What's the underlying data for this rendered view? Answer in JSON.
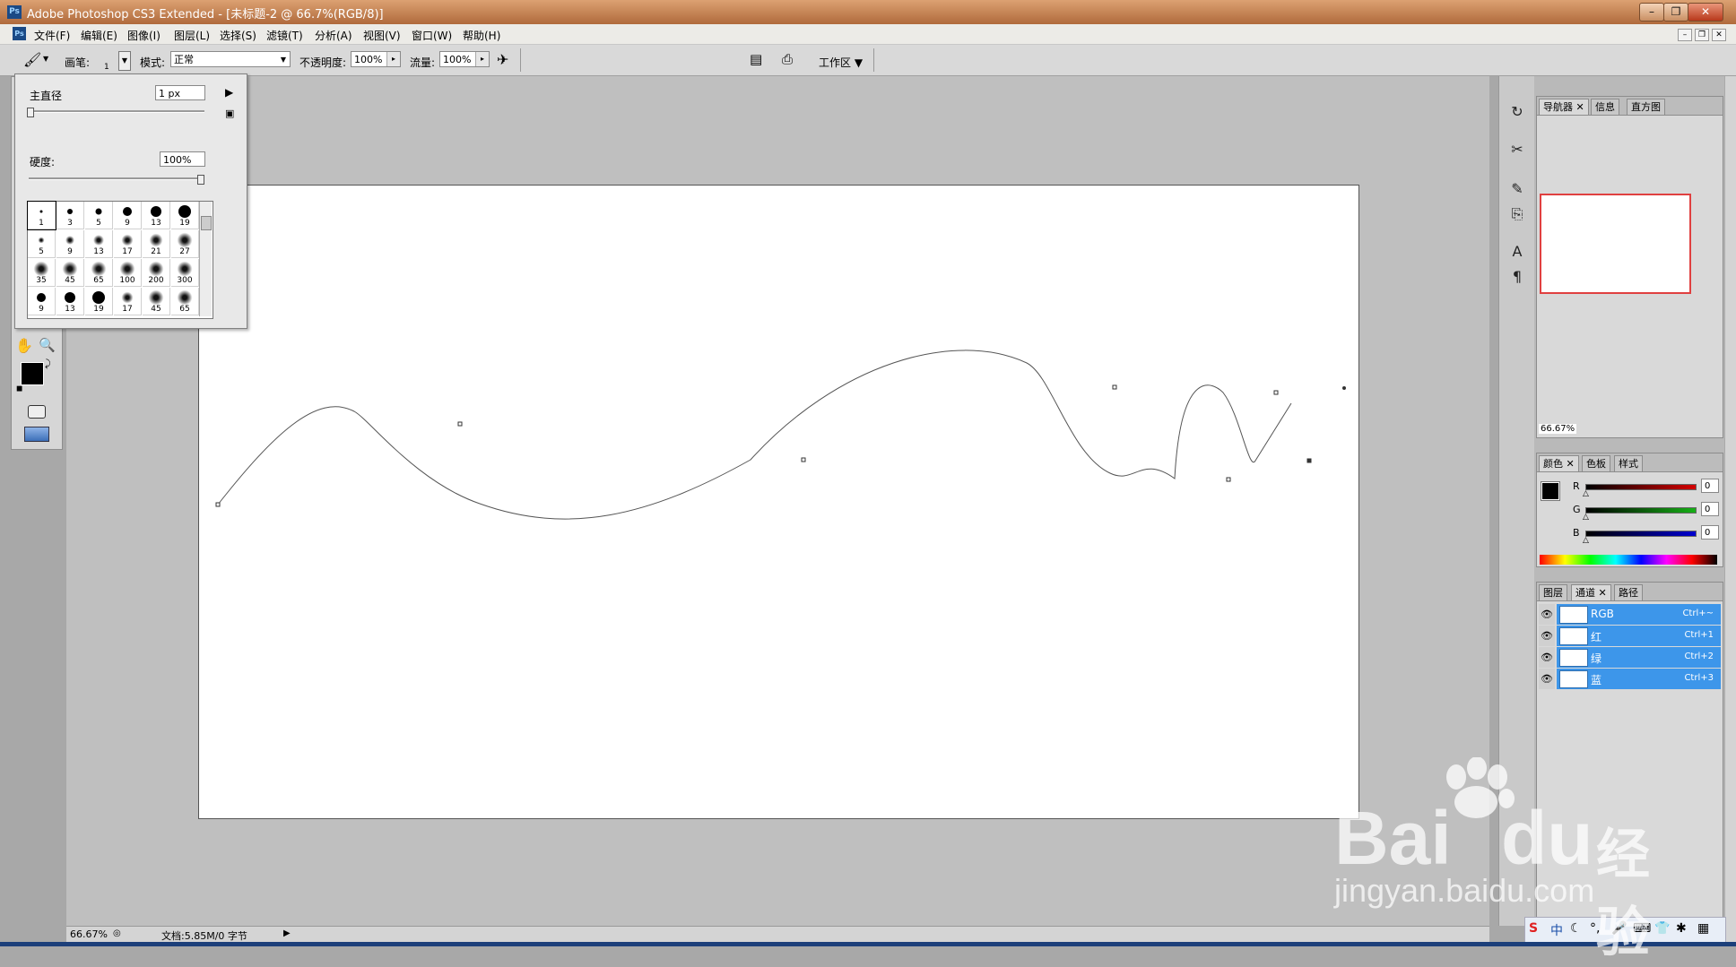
{
  "window": {
    "title": "Adobe Photoshop CS3 Extended - [未标题-2 @ 66.7%(RGB/8)]",
    "app_icon": "Ps"
  },
  "menu": [
    "文件(F)",
    "编辑(E)",
    "图像(I)",
    "图层(L)",
    "选择(S)",
    "滤镜(T)",
    "分析(A)",
    "视图(V)",
    "窗口(W)",
    "帮助(H)"
  ],
  "options": {
    "brush_label": "画笔:",
    "brush_size": "1",
    "mode_label": "模式:",
    "mode_value": "正常",
    "opacity_label": "不透明度:",
    "opacity_value": "100%",
    "flow_label": "流量:",
    "flow_value": "100%",
    "workspace_label": "工作区"
  },
  "brush_picker": {
    "diameter_label": "主直径",
    "diameter_value": "1 px",
    "diameter_level": 0.0,
    "hardness_label": "硬度:",
    "hardness_value": "100%",
    "hardness_level": 1.0,
    "presets": [
      {
        "size": "1",
        "kind": "hard"
      },
      {
        "size": "3",
        "kind": "hard"
      },
      {
        "size": "5",
        "kind": "hard"
      },
      {
        "size": "9",
        "kind": "hard"
      },
      {
        "size": "13",
        "kind": "hard"
      },
      {
        "size": "19",
        "kind": "hard"
      },
      {
        "size": "5",
        "kind": "soft"
      },
      {
        "size": "9",
        "kind": "soft"
      },
      {
        "size": "13",
        "kind": "soft"
      },
      {
        "size": "17",
        "kind": "soft"
      },
      {
        "size": "21",
        "kind": "soft"
      },
      {
        "size": "27",
        "kind": "soft"
      },
      {
        "size": "35",
        "kind": "soft"
      },
      {
        "size": "45",
        "kind": "soft"
      },
      {
        "size": "65",
        "kind": "soft"
      },
      {
        "size": "100",
        "kind": "soft"
      },
      {
        "size": "200",
        "kind": "soft"
      },
      {
        "size": "300",
        "kind": "soft"
      },
      {
        "size": "9",
        "kind": "hard"
      },
      {
        "size": "13",
        "kind": "hard"
      },
      {
        "size": "19",
        "kind": "hard"
      },
      {
        "size": "17",
        "kind": "soft"
      },
      {
        "size": "45",
        "kind": "soft"
      },
      {
        "size": "65",
        "kind": "soft"
      }
    ]
  },
  "status": {
    "zoom": "66.67%",
    "doc": "文档:5.85M/0 字节"
  },
  "navigator": {
    "tabs": [
      "导航器",
      "信息",
      "直方图"
    ],
    "zoom": "66.67%"
  },
  "color_panel": {
    "tabs": [
      "颜色",
      "色板",
      "样式"
    ],
    "channels": [
      {
        "label": "R",
        "value": "0",
        "color": "#d40000"
      },
      {
        "label": "G",
        "value": "0",
        "color": "#17b017"
      },
      {
        "label": "B",
        "value": "0",
        "color": "#0000d0"
      }
    ]
  },
  "channels_panel": {
    "tabs": [
      "图层",
      "通道",
      "路径"
    ],
    "rows": [
      {
        "name": "RGB",
        "shortcut": "Ctrl+~"
      },
      {
        "name": "红",
        "shortcut": "Ctrl+1"
      },
      {
        "name": "绿",
        "shortcut": "Ctrl+2"
      },
      {
        "name": "蓝",
        "shortcut": "Ctrl+3"
      }
    ]
  },
  "tray": {
    "ime": "中"
  },
  "watermark": {
    "brand": "Bai",
    "brand2": "du",
    "cn": "经验",
    "url": "jingyan.baidu.com"
  },
  "colors": {
    "foreground": "#000000",
    "background": "#ffffff",
    "selection": "#3d96ea",
    "title_bar": "#c47c4b"
  },
  "icons": [
    "brush-icon",
    "hand-icon",
    "zoom-icon",
    "swap-colors-icon",
    "quickmask-icon",
    "screen-mode-icon",
    "eye-icon",
    "airbrush-icon",
    "brush-panel-icon",
    "bridge-icon"
  ]
}
